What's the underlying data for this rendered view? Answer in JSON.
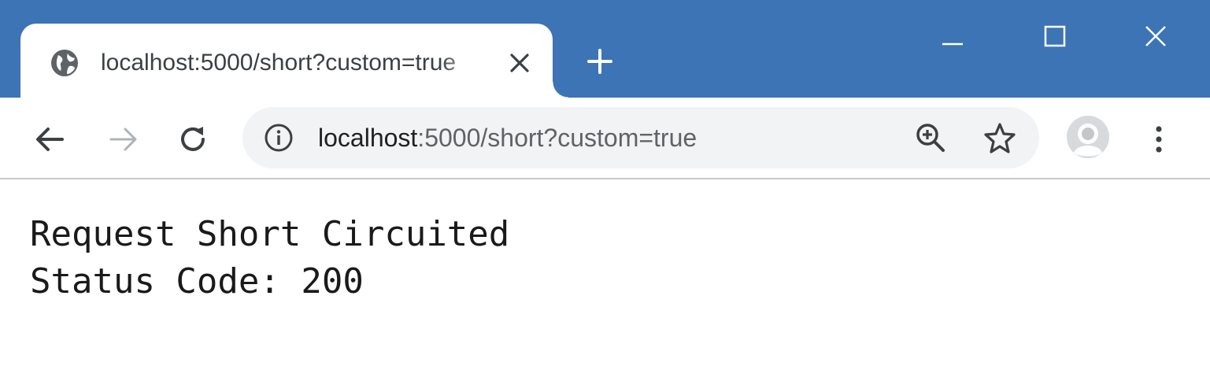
{
  "browser": {
    "tab": {
      "title": "localhost:5000/short?custom=true",
      "favicon": "globe-icon"
    },
    "address_bar": {
      "host": "localhost",
      "rest": ":5000/short?custom=true"
    },
    "colors": {
      "frame": "#3c74b5",
      "toolbar": "#ffffff",
      "omnibox": "#f1f3f4"
    }
  },
  "page": {
    "lines": [
      "Request Short Circuited",
      "Status Code: 200"
    ]
  }
}
